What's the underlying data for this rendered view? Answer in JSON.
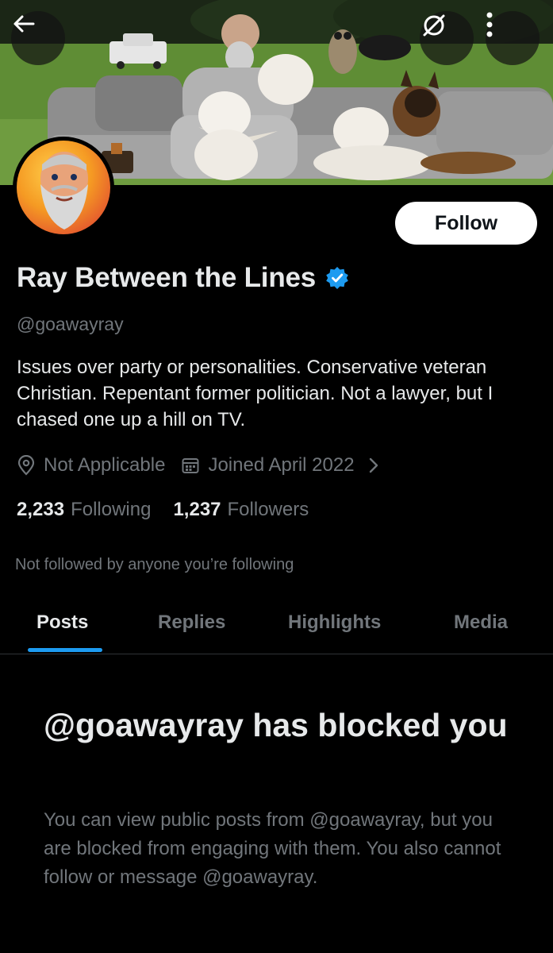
{
  "banner": {
    "description_icons": [
      "back-arrow-icon",
      "grok-icon",
      "more-vertical-icon"
    ]
  },
  "profile": {
    "display_name": "Ray Between the Lines",
    "handle": "@goawayray",
    "bio": "Issues over party or personalities. Conservative veteran Christian. Repentant former politician. Not a lawyer, but I chased one up a hill on TV.",
    "location": "Not Applicable",
    "joined": "Joined April 2022",
    "following_count": "2,233",
    "following_label": "Following",
    "followers_count": "1,237",
    "followers_label": "Followers",
    "followed_by_note": "Not followed by anyone you’re following"
  },
  "actions": {
    "follow_label": "Follow"
  },
  "tabs": [
    {
      "label": "Posts",
      "active": true
    },
    {
      "label": "Replies",
      "active": false
    },
    {
      "label": "Highlights",
      "active": false
    },
    {
      "label": "Media",
      "active": false
    }
  ],
  "blocked": {
    "title": "@goawayray has blocked you",
    "description": "You can view public posts from @goawayray, but you are blocked from engaging with them. You also cannot follow or message @goawayray."
  },
  "colors": {
    "accent": "#1d9bf0",
    "background": "#000000",
    "text_primary": "#e7e9ea",
    "text_secondary": "#71767b",
    "verified": "#1d9bf0"
  }
}
